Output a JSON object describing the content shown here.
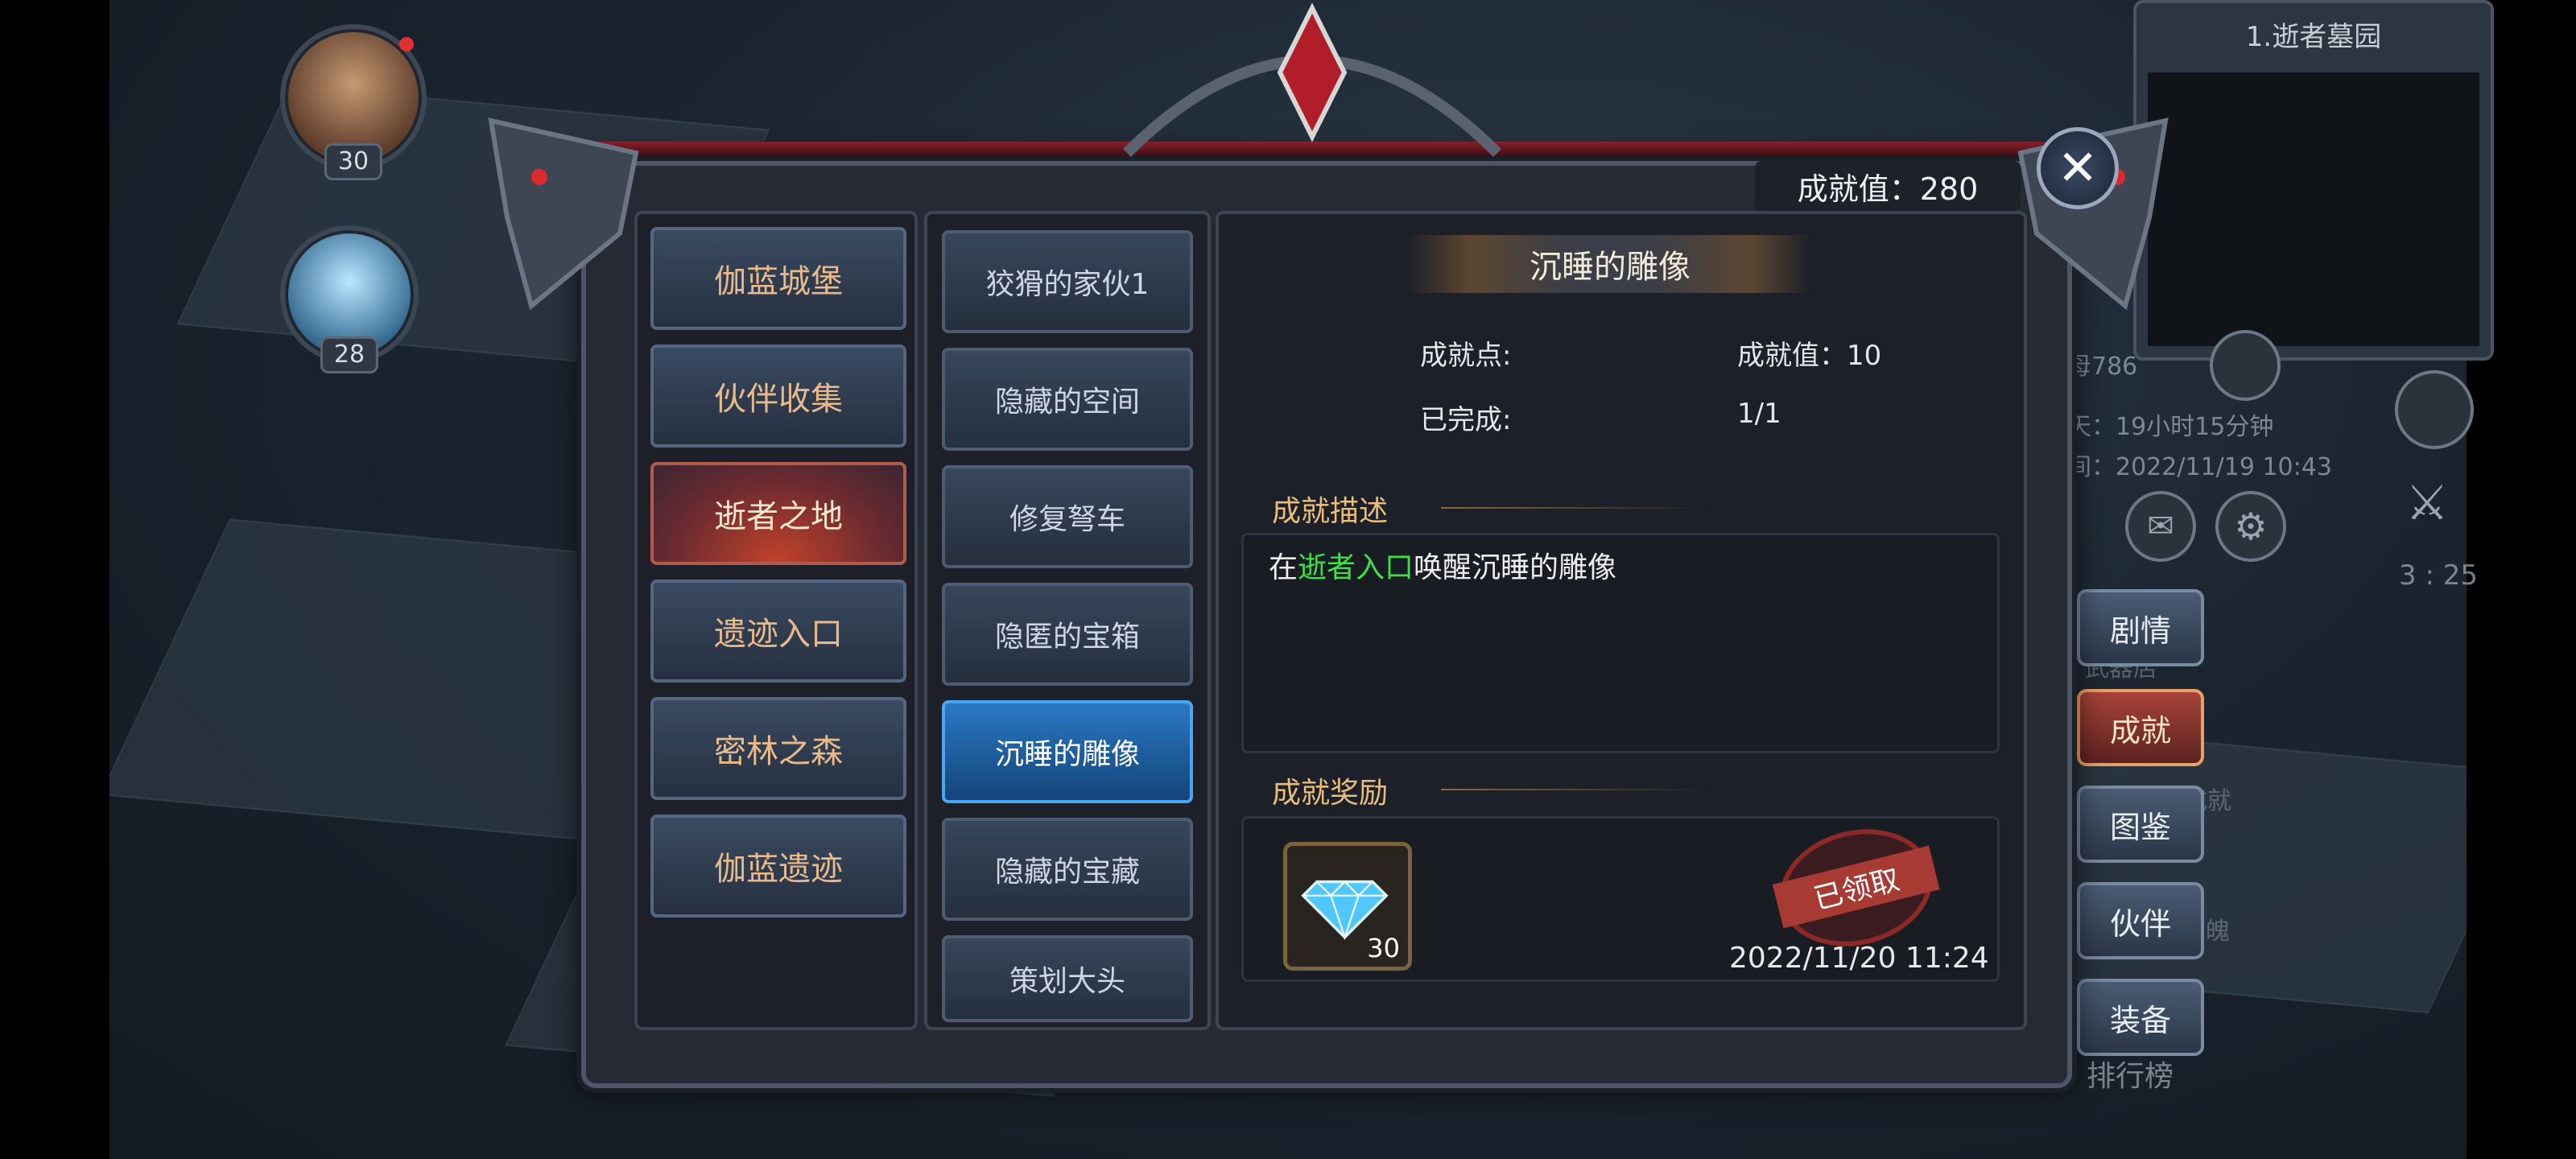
{
  "background": {
    "minimap_title": "1.逝者墓园",
    "snippets": {
      "name_fragment": "母786",
      "time_left": "天：19小时15分钟",
      "time_stamp": "间：2022/11/19 10:43",
      "clock": "3 : 25",
      "leaderboard": "排行榜",
      "faded1": "武器店",
      "faded2": "成就",
      "faded3": "魄"
    }
  },
  "party": [
    {
      "level": "30"
    },
    {
      "level": "28"
    }
  ],
  "side_menu": [
    {
      "label": "剧情"
    },
    {
      "label": "成就",
      "active": true
    },
    {
      "label": "图鉴"
    },
    {
      "label": "伙伴"
    },
    {
      "label": "装备"
    }
  ],
  "dialog": {
    "score_label": "成就值：280",
    "categories": [
      {
        "label": "伽蓝城堡"
      },
      {
        "label": "伙伴收集"
      },
      {
        "label": "逝者之地",
        "active": true
      },
      {
        "label": "遗迹入口"
      },
      {
        "label": "密林之森"
      },
      {
        "label": "伽蓝遗迹"
      }
    ],
    "achievements": [
      {
        "label": "狡猾的家伙1"
      },
      {
        "label": "隐藏的空间"
      },
      {
        "label": "修复弩车"
      },
      {
        "label": "隐匿的宝箱"
      },
      {
        "label": "沉睡的雕像",
        "active": true
      },
      {
        "label": "隐藏的宝藏"
      },
      {
        "label": "策划大头"
      }
    ],
    "detail": {
      "title": "沉睡的雕像",
      "points_label": "成就点:",
      "points_value": "成就值：10",
      "completed_label": "已完成:",
      "completed_value": "1/1",
      "description_heading": "成就描述",
      "description_prefix": "在",
      "description_location": "逝者入口",
      "description_suffix": "唤醒沉睡的雕像",
      "reward_heading": "成就奖励",
      "reward_count": "30",
      "claimed_stamp": "已领取",
      "claimed_time": "2022/11/20 11:24"
    }
  }
}
